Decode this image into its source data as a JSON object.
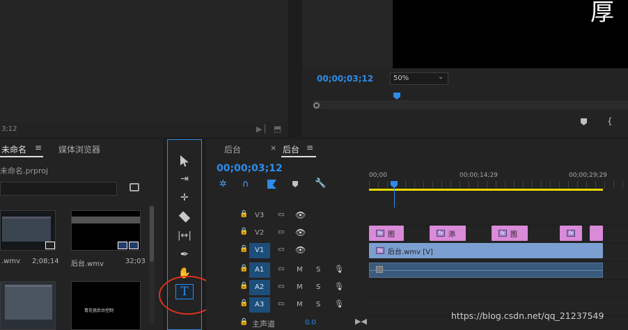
{
  "program_monitor": {
    "timecode": "00;00;03;12",
    "zoom": "50%",
    "overlay_text": "厚"
  },
  "source_monitor": {
    "timecode": "3;12"
  },
  "project_panel": {
    "tabs": [
      "未命名",
      "媒体浏览器"
    ],
    "project_file": "未命名.prproj",
    "items": [
      {
        "name": ".wmv",
        "duration": "2;08;14"
      },
      {
        "name": "后台.wmv",
        "duration": "32;03"
      },
      {
        "name": "",
        "duration": ""
      },
      {
        "name": "",
        "duration": ""
      }
    ],
    "thumb_caption": "青花瓷后台控制"
  },
  "timeline": {
    "tabs": [
      "后台",
      "后台"
    ],
    "timecode": "00;00;03;12",
    "ruler": [
      "00;00",
      "00;00;14;29",
      "00;00;29;29"
    ],
    "video_tracks": [
      {
        "name": "V3"
      },
      {
        "name": "V2"
      },
      {
        "name": "V1"
      }
    ],
    "audio_tracks": [
      {
        "name": "A1",
        "m": "M",
        "s": "S"
      },
      {
        "name": "A2",
        "m": "M",
        "s": "S"
      },
      {
        "name": "A3",
        "m": "M",
        "s": "S"
      }
    ],
    "master": {
      "label": "主声道",
      "value": "0.0"
    },
    "v2_clips": [
      {
        "label": "图"
      },
      {
        "label": "添"
      },
      {
        "label": "图"
      },
      {
        "label": ""
      },
      {
        "label": ""
      }
    ],
    "v1_clip": "后台.wmv [V]"
  },
  "tools": [
    "selection-tool",
    "track-select-tool",
    "ripple-edit-tool",
    "razor-tool",
    "slip-tool",
    "pen-tool",
    "hand-tool",
    "type-tool"
  ],
  "watermark": "https://blog.csdn.net/qq_21237549",
  "colors": {
    "accent": "#2d8ceb",
    "clip_pink": "#d98ad8",
    "clip_blue": "#7b9fd0",
    "annotation_red": "#e0301e"
  }
}
